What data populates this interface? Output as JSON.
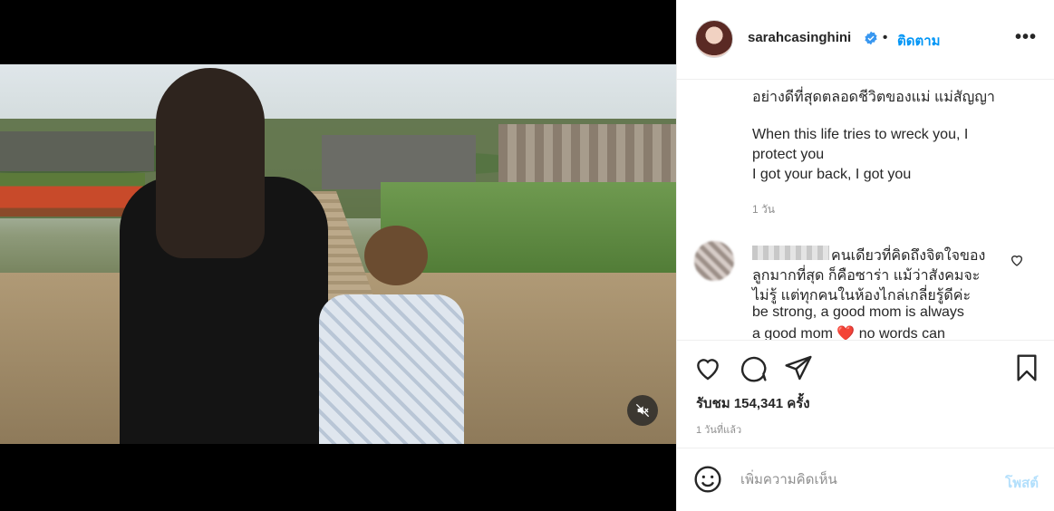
{
  "header": {
    "username": "sarahcasinghini",
    "separator": "•",
    "follow_label": "ติดตาม",
    "more_label": "•••"
  },
  "caption": {
    "lines": [
      "อย่างดีที่สุดตลอดชีวิตของแม่ แม่สัญญา",
      "When this life tries to wreck you, I",
      "protect you",
      "I got your back, I got you"
    ],
    "time": "1 วัน"
  },
  "comment": {
    "lines": [
      "คนเดียวที่คิดถึงจิตใจของ",
      "ลูกมากที่สุด ก็คือซาร่า แม้ว่าสังคมจะ",
      "ไม่รู้ แต่ทุกคนในห้องไกล่เกลี่ยรู้ดีค่ะ",
      "be strong, a good mom is always",
      "a good mom ❤️ no words can"
    ]
  },
  "stats": {
    "views": "รับชม 154,341 ครั้ง",
    "posted": "1 วันที่แล้ว"
  },
  "comment_box": {
    "placeholder": "เพิ่มความคิดเห็น",
    "post_label": "โพสต์"
  },
  "colors": {
    "follow": "#0095f6",
    "post_disabled": "#b2dffc",
    "verified": "#3897f0",
    "secondary_text": "#8e8e8e"
  },
  "icons": [
    "mute-icon",
    "verified-icon",
    "heart-icon",
    "comment-icon",
    "share-icon",
    "bookmark-icon",
    "emoji-icon"
  ]
}
